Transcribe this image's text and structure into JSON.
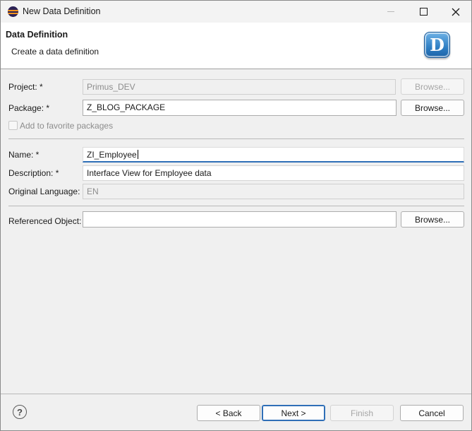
{
  "window": {
    "title": "New Data Definition",
    "icon": "eclipse-icon"
  },
  "banner": {
    "title": "Data Definition",
    "subtitle": "Create a data definition",
    "badge_letter": "D"
  },
  "form": {
    "project": {
      "label": "Project: *",
      "value": "Primus_DEV",
      "browse_label": "Browse..."
    },
    "package": {
      "label": "Package: *",
      "value": "Z_BLOG_PACKAGE",
      "browse_label": "Browse..."
    },
    "favorite": {
      "label": "Add to favorite packages",
      "checked": false
    },
    "name": {
      "label": "Name: *",
      "value": "ZI_Employee"
    },
    "description": {
      "label": "Description: *",
      "value": "Interface View for Employee data"
    },
    "original_language": {
      "label": "Original Language:",
      "value": "EN"
    },
    "referenced_object": {
      "label": "Referenced Object:",
      "value": "",
      "browse_label": "Browse..."
    }
  },
  "footer": {
    "help": "?",
    "back_label": "< Back",
    "next_label": "Next >",
    "finish_label": "Finish",
    "cancel_label": "Cancel"
  },
  "colors": {
    "accent": "#2f6fb7",
    "badge": "#2f7fc4"
  }
}
